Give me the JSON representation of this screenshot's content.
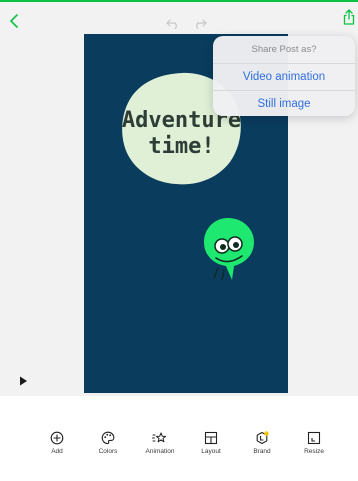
{
  "colors": {
    "accent": "#0cc243",
    "post_background": "#0a3c5e",
    "blob": "#dff0d6",
    "mascot": "#1ee86f",
    "link": "#2f6fe0"
  },
  "top_bar": {
    "back_icon": "chevron-left-icon",
    "undo_icon": "undo-icon",
    "redo_icon": "redo-icon",
    "share_icon": "share-icon"
  },
  "post": {
    "headline_line1": "Adventure",
    "headline_line2": "time!"
  },
  "share_menu": {
    "title": "Share Post as?",
    "options": [
      "Video animation",
      "Still image"
    ]
  },
  "player": {
    "play_icon": "play-icon"
  },
  "toolbar": {
    "items": [
      {
        "label": "Add",
        "icon": "add-icon"
      },
      {
        "label": "Colors",
        "icon": "palette-icon"
      },
      {
        "label": "Animation",
        "icon": "animation-icon"
      },
      {
        "label": "Layout",
        "icon": "layout-icon"
      },
      {
        "label": "Brand",
        "icon": "brand-icon"
      },
      {
        "label": "Resize",
        "icon": "resize-icon"
      }
    ]
  }
}
